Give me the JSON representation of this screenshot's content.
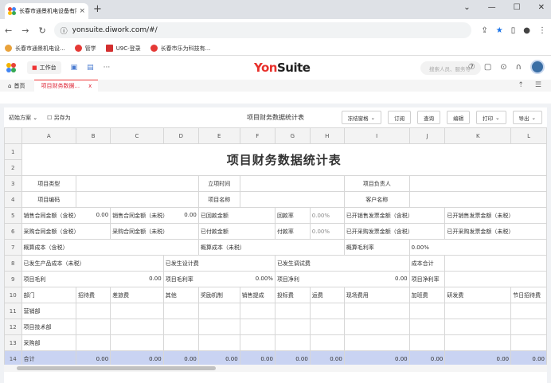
{
  "browser": {
    "tab_title": "长春市通景机电设备有限公司",
    "url": "yonsuite.diwork.com/#/",
    "bookmarks": [
      {
        "label": "长春市通景机电设...",
        "color": "#e9a23b"
      },
      {
        "label": "管学",
        "color": "#e53935"
      },
      {
        "label": "U9C-登录",
        "color": "#d32f2f"
      },
      {
        "label": "长春市乐为科技有...",
        "color": "#e53935"
      }
    ]
  },
  "app": {
    "workbench": "工作台",
    "brand_a": "Yon",
    "brand_b": "Suite",
    "search_placeholder": "搜索人员、服务等"
  },
  "page_tabs": {
    "home": "首页",
    "active": "项目财务数据...",
    "close": "x"
  },
  "toolbar": {
    "scheme": "初始方案",
    "save_as": "另存为",
    "title": "项目财务数据统计表",
    "buttons": [
      "冻结窗格",
      "订阅",
      "查询",
      "编辑",
      "打印",
      "导出"
    ]
  },
  "sheet": {
    "columns": [
      "A",
      "B",
      "C",
      "D",
      "E",
      "F",
      "G",
      "H",
      "I",
      "J",
      "K",
      "L"
    ],
    "report_title": "项目财务数据统计表",
    "r3": {
      "a": "项目类型",
      "e": "立项时间",
      "i": "项目负责人"
    },
    "r4": {
      "a": "项目编码",
      "e": "项目名称",
      "i": "客户名称"
    },
    "r5": {
      "a": "销售合同金额（含税）",
      "b": "0.00",
      "c": "销售合同金额（未税）",
      "d": "0.00",
      "e": "已回款金额",
      "g": "回款率",
      "h": "0.00%",
      "i": "已开销售发票金额（含税）",
      "k": "已开销售发票金额（未税）"
    },
    "r6": {
      "a": "采购合同金额（含税）",
      "c": "采购合同金额（未税）",
      "e": "已付款金额",
      "g": "付款率",
      "h": "0.00%",
      "i": "已开采购发票金额（含税）",
      "k": "已开采购发票金额（未税）"
    },
    "r7": {
      "a": "概算成本（含税）",
      "e": "概算成本（未税）",
      "i": "概算毛利率",
      "j": "0.00%"
    },
    "r8": {
      "a": "已发生产品成本（未税）",
      "d": "已发生设计费",
      "g": "已发生调试费",
      "j": "成本合计"
    },
    "r9": {
      "a": "项目毛利",
      "c": "0.00",
      "d": "项目毛利率",
      "f": "0.00%",
      "g": "项目净利",
      "i": "0.00",
      "j": "项目净利率"
    },
    "r10": [
      "部门",
      "招待费",
      "差旅费",
      "其他",
      "奖励机制",
      "销售提成",
      "投标费",
      "运费",
      "现场费用",
      "加班费",
      "研发费",
      "节日招待费"
    ],
    "departments": [
      "营销部",
      "项目技术部",
      "采购部"
    ],
    "total_label": "合计",
    "total_values": [
      "0.00",
      "0.00",
      "0.00",
      "0.00",
      "0.00",
      "0.00",
      "0.00",
      "0.00",
      "0.00",
      "0.00",
      "0.00"
    ],
    "row_numbers": [
      "1",
      "2",
      "3",
      "4",
      "5",
      "6",
      "7",
      "8",
      "9",
      "10",
      "11",
      "12",
      "13",
      "14"
    ]
  }
}
